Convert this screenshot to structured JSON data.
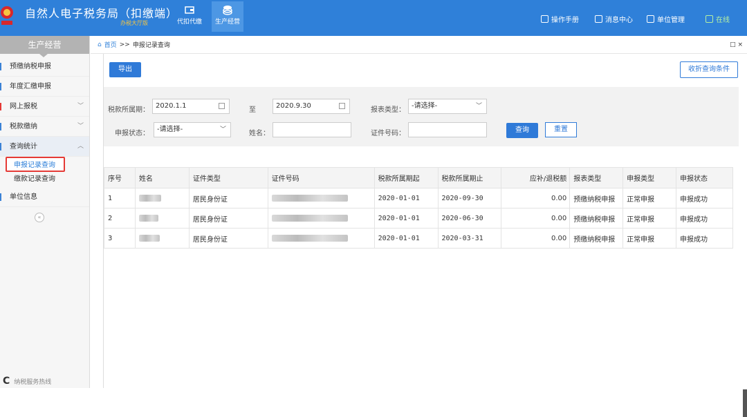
{
  "header": {
    "title": "自然人电子税务局（扣缴端）",
    "subtitle": "办税大厅版",
    "nav": [
      {
        "label": "代扣代缴",
        "icon": "wallet-icon"
      },
      {
        "label": "生产经营",
        "icon": "coins-icon"
      }
    ],
    "links": [
      {
        "label": "操作手册",
        "icon": "manual-icon"
      },
      {
        "label": "消息中心",
        "icon": "mail-icon"
      },
      {
        "label": "单位管理",
        "icon": "building-icon"
      },
      {
        "label": "在线",
        "icon": "monitor-icon"
      }
    ],
    "colors": {
      "brand": "#2f80d9",
      "online": "#b6f0a2",
      "subtitle": "#f5c542"
    }
  },
  "sidebar": {
    "header": "生产经营",
    "items": [
      {
        "label": "预缴纳税申报"
      },
      {
        "label": "年度汇缴申报"
      },
      {
        "label": "网上报税"
      },
      {
        "label": "税款缴纳"
      },
      {
        "label": "查询统计"
      },
      {
        "label": "单位信息"
      }
    ],
    "sub_items": [
      {
        "label": "申报记录查询"
      },
      {
        "label": "缴款记录查询"
      }
    ],
    "collapse": "«",
    "footer": "纳税服务热线"
  },
  "breadcrumb": {
    "home": "首页",
    "separator": ">>",
    "current": "申报记录查询",
    "controls": "□ ×"
  },
  "toolbar": {
    "export_label": "导出",
    "toggle_label": "收折查询条件"
  },
  "query": {
    "period_label": "税款所属期：",
    "period_start": "2020.1.1",
    "to_label": "至",
    "period_end": "2020.9.30",
    "form_type_label": "报表类型：",
    "form_type_value": "-请选择-",
    "status_label": "申报状态：",
    "status_value": "-请选择-",
    "name_label": "姓名：",
    "name_value": "",
    "id_label": "证件号码：",
    "id_value": "",
    "query_label": "查询",
    "reset_label": "重置"
  },
  "table": {
    "columns": [
      "序号",
      "姓名",
      "证件类型",
      "证件号码",
      "税款所属期起",
      "税款所属期止",
      "应补/退税额",
      "报表类型",
      "申报类型",
      "申报状态"
    ],
    "rows": [
      {
        "no": "1",
        "id_type": "居民身份证",
        "start": "2020-01-01",
        "end": "2020-09-30",
        "amount": "0.00",
        "form": "预缴纳税申报",
        "decl": "正常申报",
        "status": "申报成功"
      },
      {
        "no": "2",
        "id_type": "居民身份证",
        "start": "2020-01-01",
        "end": "2020-06-30",
        "amount": "0.00",
        "form": "预缴纳税申报",
        "decl": "正常申报",
        "status": "申报成功"
      },
      {
        "no": "3",
        "id_type": "居民身份证",
        "start": "2020-01-01",
        "end": "2020-03-31",
        "amount": "0.00",
        "form": "预缴纳税申报",
        "decl": "正常申报",
        "status": "申报成功"
      }
    ]
  }
}
